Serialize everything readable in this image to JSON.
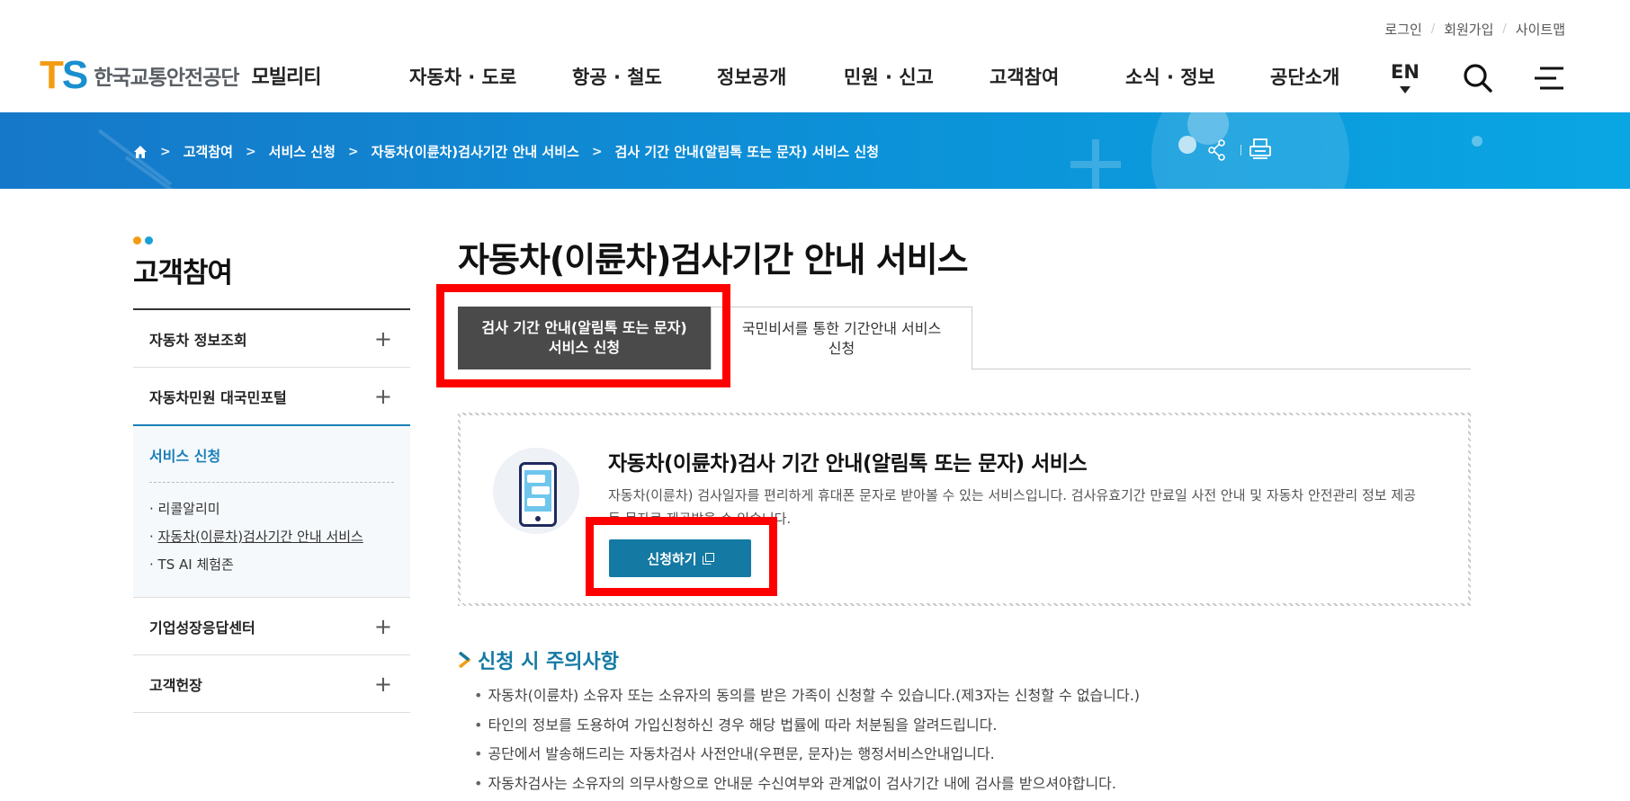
{
  "header": {
    "util_links": [
      "로그인",
      "회원가입",
      "사이트맵"
    ],
    "logo_mark_t": "T",
    "logo_mark_s": "S",
    "logo_text": "한국교통안전공단",
    "logo_sub": "모빌리티",
    "gnb": [
      "자동차 · 도로",
      "항공 · 철도",
      "정보공개",
      "민원 · 신고",
      "고객참여",
      "소식 · 정보",
      "공단소개"
    ],
    "lang": "EN"
  },
  "breadcrumb": [
    "고객참여",
    "서비스 신청",
    "자동차(이륜차)검사기간 안내 서비스",
    "검사 기간 안내(알림톡 또는 문자) 서비스 신청"
  ],
  "lnb": {
    "title": "고객참여",
    "items": [
      {
        "label": "자동차 정보조회"
      },
      {
        "label": "자동차민원 대국민포털"
      }
    ],
    "open": {
      "label": "서비스 신청",
      "subs": [
        "리콜알리미",
        "자동차(이륜차)검사기간 안내 서비스",
        "TS AI 체험존"
      ]
    },
    "items_after": [
      {
        "label": "기업성장응답센터"
      },
      {
        "label": "고객헌장"
      }
    ],
    "plus": "+"
  },
  "main": {
    "title": "자동차(이륜차)검사기간 안내 서비스",
    "tabs": [
      {
        "line1": "검사 기간 안내(알림톡 또는 문자)",
        "line2": "서비스 신청"
      },
      {
        "line1": "국민비서를 통한 기간안내 서비스",
        "line2": "신청"
      }
    ],
    "service": {
      "title": "자동차(이륜차)검사 기간 안내(알림톡 또는 문자) 서비스",
      "desc": "자동차(이륜차) 검사일자를 편리하게 휴대폰 문자로 받아볼 수 있는 서비스입니다. 검사유효기간 만료일 사전 안내 및 자동차 안전관리 정보 제공 등 문자로 제공받을 수 있습니다.",
      "button": "신청하기"
    },
    "notice_title": "신청 시 주의사항",
    "notices": [
      "자동차(이륜차) 소유자 또는 소유자의 동의를 받은 가족이 신청할 수 있습니다.(제3자는 신청할 수 없습니다.)",
      "타인의 정보를 도용하여 가입신청하신 경우 해당 법률에 따라 처분됨을 알려드립니다.",
      "공단에서 발송해드리는 자동차검사 사전안내(우편문, 문자)는 행정서비스안내입니다.",
      "자동차검사는 소유자의 의무사항으로 안내문 수신여부와 관계없이 검사기간 내에 검사를 받으셔야합니다."
    ]
  },
  "colors": {
    "accent": "#1479a3",
    "banner": "#0c92d8",
    "tab_active": "#4a4a4a",
    "highlight": "#ff0000",
    "logo_t": "#f39c12",
    "logo_s": "#1a8fd0"
  },
  "icons": [
    "home-icon",
    "search-icon",
    "hamburger-menu-icon",
    "share-icon",
    "print-icon",
    "plus-icon",
    "phone-chat-icon",
    "external-link-icon",
    "chevron-right-icon"
  ]
}
